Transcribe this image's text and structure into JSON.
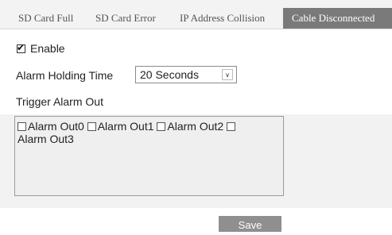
{
  "tabs": [
    {
      "label": "SD Card Full"
    },
    {
      "label": "SD Card Error"
    },
    {
      "label": "IP Address Collision"
    },
    {
      "label": "Cable Disconnected"
    }
  ],
  "enable": {
    "label": "Enable",
    "checked": true
  },
  "holding": {
    "label": "Alarm Holding Time",
    "value": "20 Seconds"
  },
  "trigger": {
    "label": "Trigger Alarm Out"
  },
  "alarm_outs": [
    {
      "label": "Alarm Out0",
      "checked": false
    },
    {
      "label": "Alarm Out1",
      "checked": false
    },
    {
      "label": "Alarm Out2",
      "checked": false
    },
    {
      "label": "Alarm Out3",
      "checked": false
    }
  ],
  "save_label": "Save"
}
